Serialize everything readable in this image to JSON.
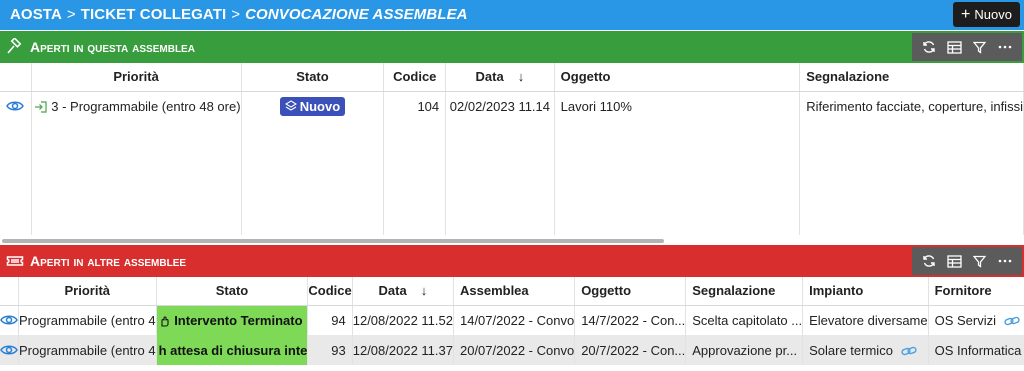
{
  "breadcrumb": {
    "items": [
      "AOSTA",
      "TICKET COLLEGATI",
      "CONVOCAZIONE ASSEMBLEA"
    ],
    "separator": ">"
  },
  "toolbar": {
    "new_label": "Nuovo"
  },
  "section1": {
    "title": "Aperti in questa assemblea",
    "color": "#389e3d",
    "columns": [
      "Priorità",
      "Stato",
      "Codice",
      "Data",
      "Oggetto",
      "Segnalazione"
    ],
    "rows": [
      {
        "priorita": "3 - Programmabile (entro 48 ore)",
        "stato": "Nuovo",
        "codice": "104",
        "data": "02/02/2023 11.14",
        "oggetto": "Lavori 110%",
        "segnalazione": "Riferimento facciate, coperture, infissi"
      }
    ]
  },
  "section2": {
    "title": "Aperti in altre assemblee",
    "color": "#d92e2e",
    "columns": [
      "Priorità",
      "Stato",
      "Codice",
      "Data",
      "Assemblea",
      "Oggetto",
      "Segnalazione",
      "Impianto",
      "Fornitore"
    ],
    "rows": [
      {
        "priorita": "Programmabile (entro 4",
        "stato": "Intervento Terminato",
        "codice": "94",
        "data": "12/08/2022 11.52",
        "assemblea": "14/07/2022 - Convo",
        "oggetto": "14/7/2022 - Con...",
        "segnalazione": "Scelta capitolato ...",
        "impianto": "Elevatore diversame",
        "fornitore": "OS Servizi"
      },
      {
        "priorita": "Programmabile (entro 4",
        "stato": "h attesa di chiusura inte",
        "codice": "93",
        "data": "12/08/2022 11.37",
        "assemblea": "20/07/2022 - Convo",
        "oggetto": "20/7/2022 - Con...",
        "segnalazione": "Approvazione pr...",
        "impianto": "Solare termico",
        "fornitore": "OS Informatica"
      }
    ]
  },
  "colors": {
    "topbar": "#2a96e6",
    "badge_nuovo": "#3b50b8",
    "status_green": "#7ed957",
    "eye": "#2a7fd4"
  },
  "icons": {
    "section1": "gavel-icon",
    "section2": "ticket-icon",
    "tools": [
      "refresh-icon",
      "table-icon",
      "filter-icon",
      "more-icon"
    ]
  }
}
